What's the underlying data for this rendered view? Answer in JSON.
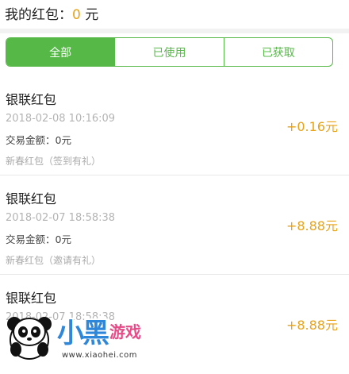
{
  "header": {
    "label": "我的红包：",
    "amount": "0",
    "unit": "元"
  },
  "tabs": [
    {
      "label": "全部",
      "active": true
    },
    {
      "label": "已使用",
      "active": false
    },
    {
      "label": "已获取",
      "active": false
    }
  ],
  "items": [
    {
      "title": "银联红包",
      "time": "2018-02-08 10:16:09",
      "trade": "交易金额：0元",
      "desc": "新春红包（签到有礼）",
      "value": "+0.16元"
    },
    {
      "title": "银联红包",
      "time": "2018-02-07 18:58:38",
      "trade": "交易金额：0元",
      "desc": "新春红包（邀请有礼）",
      "value": "+8.88元"
    },
    {
      "title": "银联红包",
      "time": "2018-02-07 18:58:38",
      "trade": "",
      "desc": "",
      "value": "+8.88元"
    }
  ],
  "watermark": {
    "brand": "小黑",
    "sub": "游戏",
    "url": "www.xiaohei.com"
  },
  "colors": {
    "accent_green": "#56b947",
    "amount_gold": "#e8a317"
  }
}
